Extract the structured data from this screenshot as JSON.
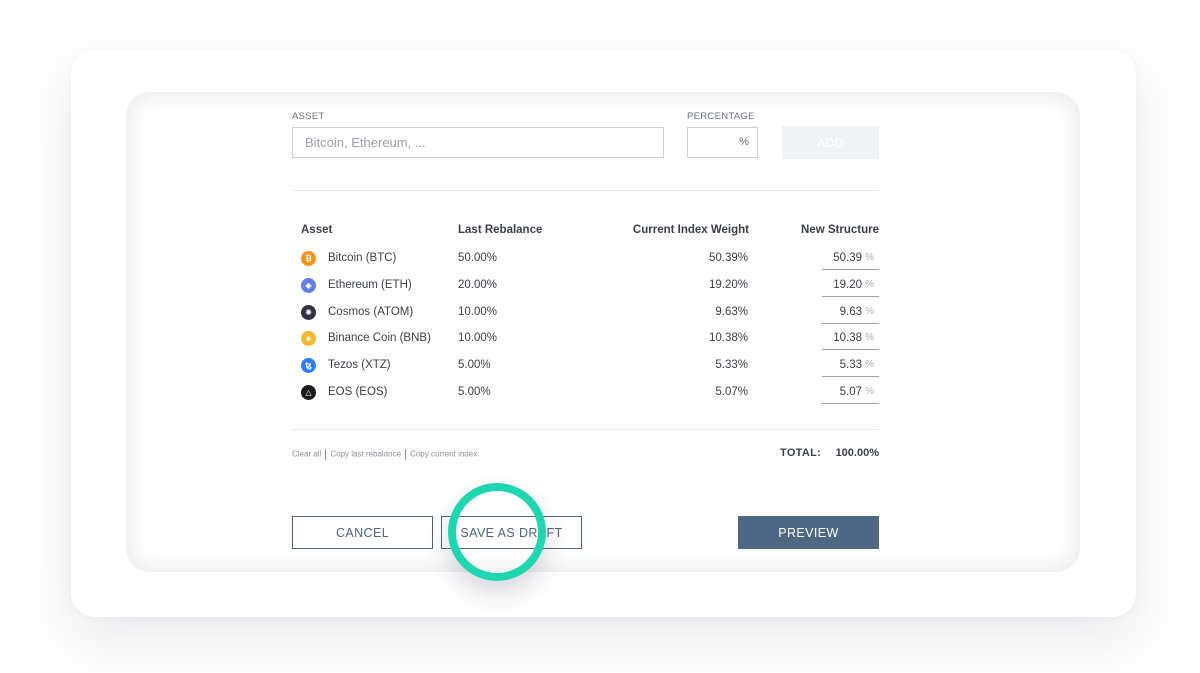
{
  "form": {
    "asset_label": "ASSET",
    "asset_placeholder": "Bitcoin, Ethereum, ...",
    "percentage_label": "PERCENTAGE",
    "percent_symbol": "%",
    "add_label": "ADD"
  },
  "table": {
    "headers": {
      "asset": "Asset",
      "last_rebalance": "Last Rebalance",
      "current_weight": "Current Index Weight",
      "new_structure": "New Structure"
    },
    "rows": [
      {
        "name": "Bitcoin (BTC)",
        "icon": "bitcoin-icon",
        "glyph": "₿",
        "color": "#f7931a",
        "last": "50.00%",
        "current": "50.39%",
        "new": "50.39",
        "pct": "%"
      },
      {
        "name": "Ethereum (ETH)",
        "icon": "ethereum-icon",
        "glyph": "◆",
        "color": "#627eea",
        "last": "20.00%",
        "current": "19.20%",
        "new": "19.20",
        "pct": "%"
      },
      {
        "name": "Cosmos (ATOM)",
        "icon": "cosmos-icon",
        "glyph": "✺",
        "color": "#2e3148",
        "last": "10.00%",
        "current": "9.63%",
        "new": "9.63",
        "pct": "%"
      },
      {
        "name": "Binance Coin (BNB)",
        "icon": "binance-icon",
        "glyph": "◈",
        "color": "#f3ba2f",
        "last": "10.00%",
        "current": "10.38%",
        "new": "10.38",
        "pct": "%"
      },
      {
        "name": "Tezos (XTZ)",
        "icon": "tezos-icon",
        "glyph": "ꜩ",
        "color": "#2c7df7",
        "last": "5.00%",
        "current": "5.33%",
        "new": "5.33",
        "pct": "%"
      },
      {
        "name": "EOS (EOS)",
        "icon": "eos-icon",
        "glyph": "△",
        "color": "#1a1a1a",
        "last": "5.00%",
        "current": "5.07%",
        "new": "5.07",
        "pct": "%"
      }
    ]
  },
  "links": {
    "clear_all": "Clear all",
    "copy_last": "Copy last rebalance",
    "copy_current": "Copy current index"
  },
  "total": {
    "label": "TOTAL:",
    "value": "100.00%"
  },
  "buttons": {
    "cancel": "CANCEL",
    "save_draft": "SAVE AS DRAFT",
    "preview": "PREVIEW"
  },
  "colors": {
    "primary": "#4d6882",
    "highlight": "#20d6b1"
  }
}
